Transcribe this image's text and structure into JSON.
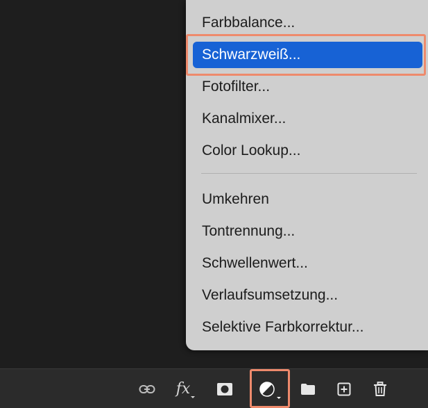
{
  "menu": {
    "items": [
      {
        "label": "Farbbalance...",
        "selected": false
      },
      {
        "label": "Schwarzweiß...",
        "selected": true
      },
      {
        "label": "Fotofilter...",
        "selected": false
      },
      {
        "label": "Kanalmixer...",
        "selected": false
      },
      {
        "label": "Color Lookup...",
        "selected": false
      },
      {
        "label": "Umkehren",
        "selected": false
      },
      {
        "label": "Tontrennung...",
        "selected": false
      },
      {
        "label": "Schwellenwert...",
        "selected": false
      },
      {
        "label": "Verlaufsumsetzung...",
        "selected": false
      },
      {
        "label": "Selektive Farbkorrektur...",
        "selected": false
      }
    ]
  },
  "toolbar": {
    "fx_label": "fx",
    "icons": [
      "link-icon",
      "fx-icon",
      "mask-icon",
      "adjustment-layer-icon",
      "folder-icon",
      "new-layer-icon",
      "trash-icon"
    ]
  },
  "colors": {
    "selection": "#1762d5",
    "annotation": "#ee8a6c",
    "menu_bg": "#cfcfcf",
    "toolbar_bg": "#2b2b2b"
  }
}
